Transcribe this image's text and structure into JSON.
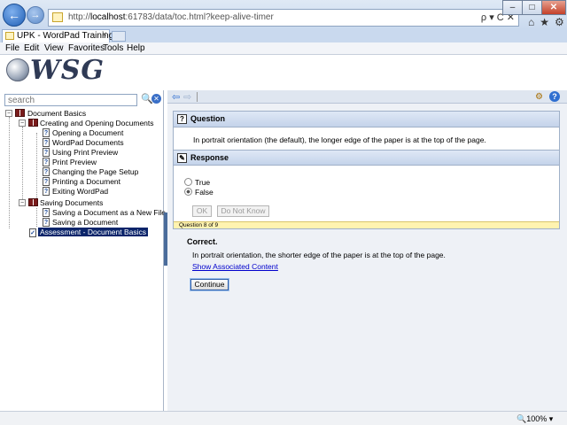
{
  "browser": {
    "address_prefix": "http://",
    "address_host": "localhost",
    "address_rest": ":61783/data/toc.html?keep-alive-timer",
    "address_tools": "ρ ▾ C ✕",
    "tab_title": "UPK - WordPad Training",
    "tab_close": "×",
    "back_glyph": "←",
    "forward_glyph": "→",
    "win_min": "–",
    "win_max": "□",
    "win_close": "✕",
    "right_icons": "⌂★⚙",
    "menus": [
      "File",
      "Edit",
      "View",
      "Favorites",
      "Tools",
      "Help"
    ]
  },
  "header": {
    "logo_text": "WSG"
  },
  "toc": {
    "search_placeholder": "search",
    "root": "Document Basics",
    "group1": "Creating and Opening Documents",
    "group1_items": [
      "Opening a Document",
      "WordPad Documents",
      "Using Print Preview",
      "Print Preview",
      "Changing the Page Setup",
      "Printing a Document",
      "Exiting WordPad"
    ],
    "group2": "Saving Documents",
    "group2_items": [
      "Saving a Document as a New File",
      "Saving a Document"
    ],
    "assessment": "Assessment - Document Basics"
  },
  "content": {
    "question_heading": "Question",
    "question_text": "In portrait orientation (the default), the longer edge of the paper is at the top of the page.",
    "response_heading": "Response",
    "option_true": "True",
    "option_false": "False",
    "selected_option": "False",
    "ok_label": "OK",
    "dont_know_label": "Do Not Know",
    "progress_text": "Question 8 of 9",
    "feedback_title": "Correct.",
    "feedback_text": "In portrait orientation, the shorter edge of the paper is at the top of the page.",
    "associated_link": "Show Associated Content",
    "continue_label": "Continue"
  },
  "status": {
    "zoom": "100%"
  }
}
